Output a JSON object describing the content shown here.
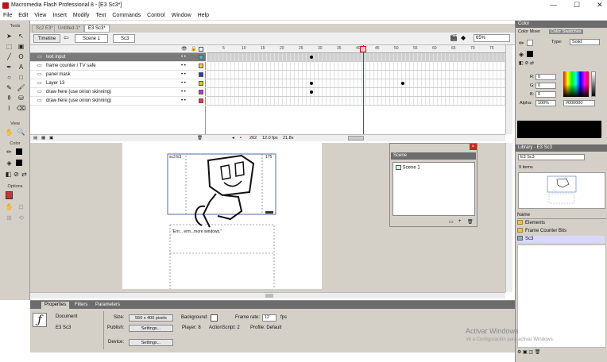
{
  "window": {
    "title": "Macromedia Flash Professional 8 - [E3 Sc3*]",
    "controls": [
      "—",
      "☐",
      "✕"
    ]
  },
  "menu": [
    "File",
    "Edit",
    "View",
    "Insert",
    "Modify",
    "Text",
    "Commands",
    "Control",
    "Window",
    "Help"
  ],
  "tools": {
    "header": "Tools",
    "view_label": "View",
    "colors_label": "Color",
    "options_label": "Options"
  },
  "doc_tabs": [
    "Sc2 E3*",
    "Untitled-1*",
    "E3 Sc3*"
  ],
  "edit_bar": {
    "timeline_label": "Timeline",
    "scene": "Scene 1",
    "symbol": "Sc3",
    "zoom": "65%"
  },
  "layers": [
    {
      "name": "text input",
      "selected": true,
      "color": "#3fbfbf"
    },
    {
      "name": "frame counter / TV safe",
      "selected": false,
      "color": "#ffcc33"
    },
    {
      "name": "panel mask",
      "selected": false,
      "color": "#3333cc"
    },
    {
      "name": "Layer 13",
      "selected": false,
      "color": "#cccc33"
    },
    {
      "name": "draw here (use onion skinning)",
      "selected": false,
      "color": "#cc33cc"
    },
    {
      "name": "draw here (use onion skinning)",
      "selected": false,
      "color": "#ff3333"
    }
  ],
  "ruler_ticks": [
    "5",
    "10",
    "15",
    "20",
    "25",
    "30",
    "35",
    "40",
    "45",
    "50",
    "55",
    "60",
    "65",
    "70",
    "75",
    "80"
  ],
  "timeline_status": {
    "frame": "262",
    "fps": "12.0 fps",
    "time": "21.8s"
  },
  "stage": {
    "frame_left": "sc3 E3",
    "frame_right": "175",
    "caption": "\"Errr... erm...more windows.\""
  },
  "scene_panel": {
    "title": "Scene",
    "item": "Scene 1"
  },
  "properties": {
    "tabs": [
      "Properties",
      "Filters",
      "Parameters"
    ],
    "type": "Document",
    "name": "E3 Sc3",
    "size_label": "Size:",
    "size_value": "550 x 400 pixels",
    "background_label": "Background:",
    "frame_rate_label": "Frame rate:",
    "frame_rate": "12",
    "fps_unit": "fps",
    "publish_label": "Publish:",
    "settings_label": "Settings...",
    "player": "Player: 8",
    "actionscript": "ActionScript: 2",
    "profile": "Profile: Default",
    "device_label": "Device:"
  },
  "color_panel": {
    "title": "Color",
    "tabs": [
      "Color Mixer",
      "Color Swatches"
    ],
    "type_label": "Type:",
    "type_value": "Solid",
    "r_label": "R:",
    "r": "0",
    "g_label": "G:",
    "g": "0",
    "b_label": "B:",
    "b": "0",
    "alpha_label": "Alpha:",
    "alpha": "100%",
    "hex": "#000000"
  },
  "library": {
    "title": "Library - E3 Sc3",
    "doc": "E3 Sc3",
    "count": "9 items",
    "name_col": "Name",
    "items": [
      "Elements",
      "Frame Counter Bits",
      "Sc3"
    ]
  },
  "watermark": {
    "title": "Activar Windows",
    "subtitle": "Ve a Configuración para activar Windows."
  }
}
